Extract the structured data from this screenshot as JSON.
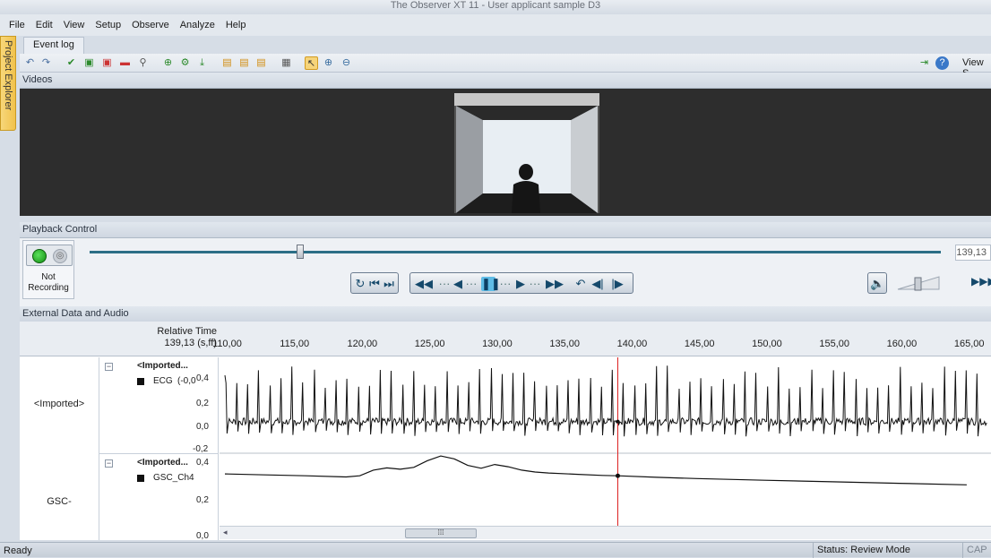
{
  "window": {
    "title": "The Observer XT 11 - User applicant sample D3"
  },
  "menu": {
    "items": [
      "File",
      "Edit",
      "View",
      "Setup",
      "Observe",
      "Analyze",
      "Help"
    ]
  },
  "sidebar": {
    "project_explorer": "Project Explorer"
  },
  "tabs": {
    "event_log": "Event log"
  },
  "toolbar": {
    "view_settings": "View S"
  },
  "videos": {
    "section_title": "Videos"
  },
  "playback": {
    "section_title": "Playback Control",
    "recording_status": "Not Recording",
    "current_time": "139,13",
    "slider_position": 0.247,
    "volume_level": 0.55
  },
  "external": {
    "section_title": "External Data and Audio",
    "relative_time_label": "Relative Time",
    "current_time_label": "139,13 (s,ff)",
    "time_ticks": [
      "110,00",
      "115,00",
      "120,00",
      "125,00",
      "130,00",
      "135,00",
      "140,00",
      "145,00",
      "150,00",
      "155,00",
      "160,00",
      "165,00"
    ],
    "rows": [
      {
        "label": "<Imported>",
        "group": "<Imported...",
        "channel": "ECG",
        "channel_extra": "(-0,0",
        "y_ticks": [
          "0,4",
          "0,2",
          "0,0",
          "-0,2"
        ]
      },
      {
        "label": "GSC-",
        "group": "<Imported...",
        "channel": "GSC_Ch4",
        "y_ticks": [
          "0,4",
          "0,2",
          "0,0"
        ]
      }
    ]
  },
  "chart_data": [
    {
      "type": "line",
      "title": "",
      "xlabel": "Relative Time",
      "ylabel": "",
      "xlim": [
        109.6,
        166.8
      ],
      "ylim": [
        -0.2,
        0.4
      ],
      "cursor_x": 139.13,
      "series": [
        {
          "name": "ECG",
          "x": [
            110,
            165
          ],
          "y": [
            0.0,
            0.0
          ],
          "pattern": "spikes"
        }
      ]
    },
    {
      "type": "line",
      "title": "",
      "xlabel": "Relative Time",
      "ylabel": "",
      "xlim": [
        109.6,
        166.8
      ],
      "ylim": [
        0.0,
        0.4
      ],
      "cursor_x": 139.13,
      "series": [
        {
          "name": "GSC_Ch4",
          "x": [
            110,
            113,
            116,
            119,
            120,
            121,
            122,
            123,
            124,
            125,
            126,
            127,
            128,
            129,
            130,
            131,
            132,
            133,
            134,
            136,
            138,
            139.13,
            142,
            145,
            150,
            155,
            160,
            165
          ],
          "y": [
            0.29,
            0.285,
            0.28,
            0.274,
            0.28,
            0.31,
            0.322,
            0.315,
            0.325,
            0.36,
            0.385,
            0.37,
            0.335,
            0.32,
            0.34,
            0.328,
            0.31,
            0.3,
            0.295,
            0.288,
            0.282,
            0.28,
            0.272,
            0.265,
            0.256,
            0.248,
            0.24,
            0.232
          ]
        }
      ]
    }
  ]
}
